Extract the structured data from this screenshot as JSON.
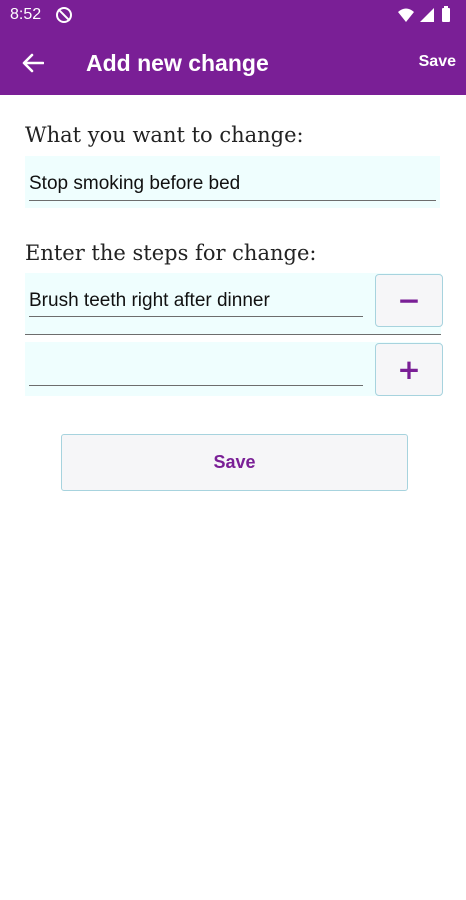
{
  "status": {
    "time": "8:52"
  },
  "app_bar": {
    "title": "Add new change",
    "save_label": "Save"
  },
  "form": {
    "change_label": "What you want to change:",
    "change_value": "Stop smoking before bed",
    "steps_label": "Enter the steps for change:",
    "steps": [
      {
        "value": "Brush teeth right after dinner",
        "button": "−"
      },
      {
        "value": "",
        "button": "+"
      }
    ],
    "save_button": "Save"
  },
  "colors": {
    "brand": "#7a1f96",
    "field_bg": "#effefe",
    "button_border": "#a7d3de"
  },
  "icons": [
    "dnd-icon",
    "wifi-icon",
    "signal-icon",
    "battery-icon",
    "back-arrow-icon"
  ]
}
